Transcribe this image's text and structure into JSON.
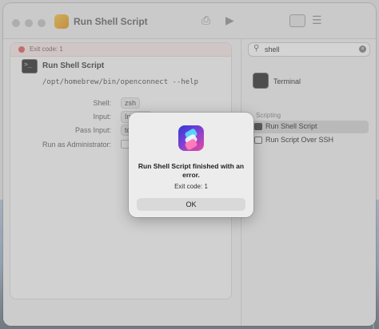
{
  "window": {
    "title": "Run Shell Script"
  },
  "editor": {
    "error_text": "Exit code: 1",
    "action_title": "Run Shell Script",
    "script": "/opt/homebrew/bin/openconnect --help",
    "params": {
      "shell_label": "Shell:",
      "shell_value": "zsh",
      "input_label": "Input:",
      "input_value": "Input ◇",
      "pass_input_label": "Pass Input:",
      "pass_input_value": "to s",
      "run_as_admin_label": "Run as Administrator:"
    }
  },
  "library": {
    "search": {
      "value": "shell"
    },
    "top_result": "Terminal",
    "section": "Scripting",
    "items": [
      {
        "label": "Run Shell Script"
      },
      {
        "label": "Run Script Over SSH"
      }
    ]
  },
  "dialog": {
    "title": "Run Shell Script finished with an error.",
    "message": "Exit code: 1",
    "ok_label": "OK"
  }
}
